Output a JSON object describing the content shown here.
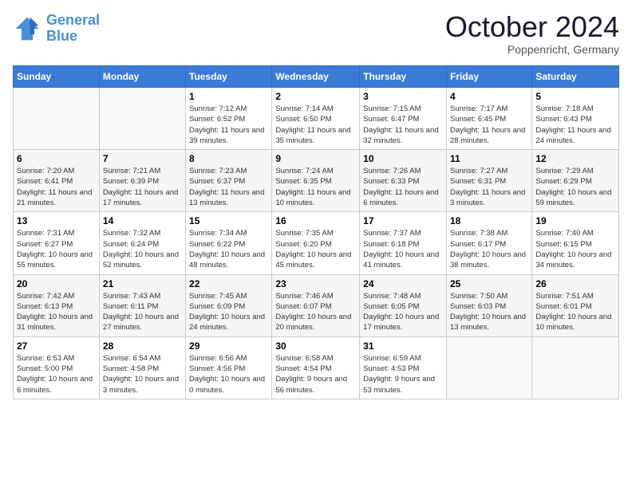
{
  "header": {
    "logo_line1": "General",
    "logo_line2": "Blue",
    "month": "October 2024",
    "location": "Poppenricht, Germany"
  },
  "days_of_week": [
    "Sunday",
    "Monday",
    "Tuesday",
    "Wednesday",
    "Thursday",
    "Friday",
    "Saturday"
  ],
  "weeks": [
    [
      {
        "day": "",
        "info": ""
      },
      {
        "day": "",
        "info": ""
      },
      {
        "day": "1",
        "info": "Sunrise: 7:12 AM\nSunset: 6:52 PM\nDaylight: 11 hours and 39 minutes."
      },
      {
        "day": "2",
        "info": "Sunrise: 7:14 AM\nSunset: 6:50 PM\nDaylight: 11 hours and 35 minutes."
      },
      {
        "day": "3",
        "info": "Sunrise: 7:15 AM\nSunset: 6:47 PM\nDaylight: 11 hours and 32 minutes."
      },
      {
        "day": "4",
        "info": "Sunrise: 7:17 AM\nSunset: 6:45 PM\nDaylight: 11 hours and 28 minutes."
      },
      {
        "day": "5",
        "info": "Sunrise: 7:18 AM\nSunset: 6:43 PM\nDaylight: 11 hours and 24 minutes."
      }
    ],
    [
      {
        "day": "6",
        "info": "Sunrise: 7:20 AM\nSunset: 6:41 PM\nDaylight: 11 hours and 21 minutes."
      },
      {
        "day": "7",
        "info": "Sunrise: 7:21 AM\nSunset: 6:39 PM\nDaylight: 11 hours and 17 minutes."
      },
      {
        "day": "8",
        "info": "Sunrise: 7:23 AM\nSunset: 6:37 PM\nDaylight: 11 hours and 13 minutes."
      },
      {
        "day": "9",
        "info": "Sunrise: 7:24 AM\nSunset: 6:35 PM\nDaylight: 11 hours and 10 minutes."
      },
      {
        "day": "10",
        "info": "Sunrise: 7:26 AM\nSunset: 6:33 PM\nDaylight: 11 hours and 6 minutes."
      },
      {
        "day": "11",
        "info": "Sunrise: 7:27 AM\nSunset: 6:31 PM\nDaylight: 11 hours and 3 minutes."
      },
      {
        "day": "12",
        "info": "Sunrise: 7:29 AM\nSunset: 6:29 PM\nDaylight: 10 hours and 59 minutes."
      }
    ],
    [
      {
        "day": "13",
        "info": "Sunrise: 7:31 AM\nSunset: 6:27 PM\nDaylight: 10 hours and 55 minutes."
      },
      {
        "day": "14",
        "info": "Sunrise: 7:32 AM\nSunset: 6:24 PM\nDaylight: 10 hours and 52 minutes."
      },
      {
        "day": "15",
        "info": "Sunrise: 7:34 AM\nSunset: 6:22 PM\nDaylight: 10 hours and 48 minutes."
      },
      {
        "day": "16",
        "info": "Sunrise: 7:35 AM\nSunset: 6:20 PM\nDaylight: 10 hours and 45 minutes."
      },
      {
        "day": "17",
        "info": "Sunrise: 7:37 AM\nSunset: 6:18 PM\nDaylight: 10 hours and 41 minutes."
      },
      {
        "day": "18",
        "info": "Sunrise: 7:38 AM\nSunset: 6:17 PM\nDaylight: 10 hours and 38 minutes."
      },
      {
        "day": "19",
        "info": "Sunrise: 7:40 AM\nSunset: 6:15 PM\nDaylight: 10 hours and 34 minutes."
      }
    ],
    [
      {
        "day": "20",
        "info": "Sunrise: 7:42 AM\nSunset: 6:13 PM\nDaylight: 10 hours and 31 minutes."
      },
      {
        "day": "21",
        "info": "Sunrise: 7:43 AM\nSunset: 6:11 PM\nDaylight: 10 hours and 27 minutes."
      },
      {
        "day": "22",
        "info": "Sunrise: 7:45 AM\nSunset: 6:09 PM\nDaylight: 10 hours and 24 minutes."
      },
      {
        "day": "23",
        "info": "Sunrise: 7:46 AM\nSunset: 6:07 PM\nDaylight: 10 hours and 20 minutes."
      },
      {
        "day": "24",
        "info": "Sunrise: 7:48 AM\nSunset: 6:05 PM\nDaylight: 10 hours and 17 minutes."
      },
      {
        "day": "25",
        "info": "Sunrise: 7:50 AM\nSunset: 6:03 PM\nDaylight: 10 hours and 13 minutes."
      },
      {
        "day": "26",
        "info": "Sunrise: 7:51 AM\nSunset: 6:01 PM\nDaylight: 10 hours and 10 minutes."
      }
    ],
    [
      {
        "day": "27",
        "info": "Sunrise: 6:53 AM\nSunset: 5:00 PM\nDaylight: 10 hours and 6 minutes."
      },
      {
        "day": "28",
        "info": "Sunrise: 6:54 AM\nSunset: 4:58 PM\nDaylight: 10 hours and 3 minutes."
      },
      {
        "day": "29",
        "info": "Sunrise: 6:56 AM\nSunset: 4:56 PM\nDaylight: 10 hours and 0 minutes."
      },
      {
        "day": "30",
        "info": "Sunrise: 6:58 AM\nSunset: 4:54 PM\nDaylight: 9 hours and 56 minutes."
      },
      {
        "day": "31",
        "info": "Sunrise: 6:59 AM\nSunset: 4:53 PM\nDaylight: 9 hours and 53 minutes."
      },
      {
        "day": "",
        "info": ""
      },
      {
        "day": "",
        "info": ""
      }
    ]
  ]
}
